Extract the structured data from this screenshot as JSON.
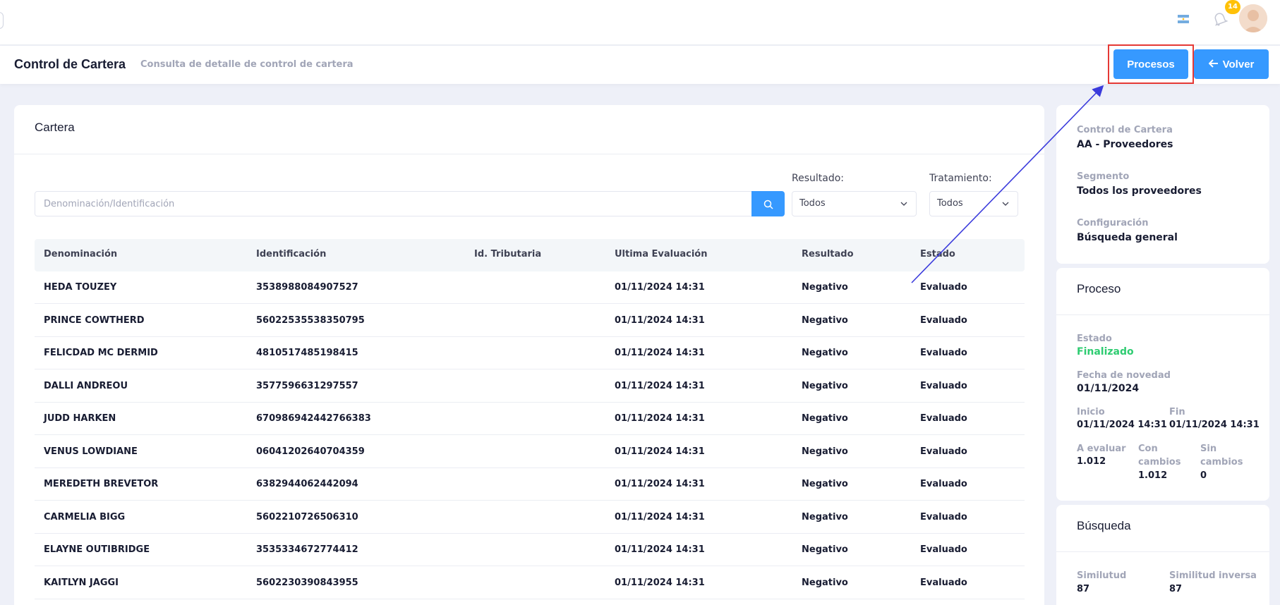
{
  "topbar": {
    "notification_count": "14",
    "flag_icon": "argentina-flag-icon",
    "bell_icon": "bell-icon"
  },
  "header": {
    "title": "Control de Cartera",
    "subtitle": "Consulta de detalle de control de cartera",
    "procesos_label": "Procesos",
    "volver_label": "Volver"
  },
  "cartera": {
    "title": "Cartera",
    "search_placeholder": "Denominación/Identificación",
    "resultado_label": "Resultado:",
    "resultado_value": "Todos",
    "tratamiento_label": "Tratamiento:",
    "tratamiento_value": "Todos",
    "columns": [
      "Denominación",
      "Identificación",
      "Id. Tributaria",
      "Ultima Evaluación",
      "Resultado",
      "Estado"
    ],
    "rows": [
      [
        "HEDA TOUZEY",
        "3538988084907527",
        "",
        "01/11/2024 14:31",
        "Negativo",
        "Evaluado"
      ],
      [
        "PRINCE COWTHERD",
        "56022535538350795",
        "",
        "01/11/2024 14:31",
        "Negativo",
        "Evaluado"
      ],
      [
        "FELICDAD MC DERMID",
        "4810517485198415",
        "",
        "01/11/2024 14:31",
        "Negativo",
        "Evaluado"
      ],
      [
        "DALLI ANDREOU",
        "3577596631297557",
        "",
        "01/11/2024 14:31",
        "Negativo",
        "Evaluado"
      ],
      [
        "JUDD HARKEN",
        "670986942442766383",
        "",
        "01/11/2024 14:31",
        "Negativo",
        "Evaluado"
      ],
      [
        "VENUS LOWDIANE",
        "06041202640704359",
        "",
        "01/11/2024 14:31",
        "Negativo",
        "Evaluado"
      ],
      [
        "MEREDETH BREVETOR",
        "6382944062442094",
        "",
        "01/11/2024 14:31",
        "Negativo",
        "Evaluado"
      ],
      [
        "CARMELIA BIGG",
        "5602210726506310",
        "",
        "01/11/2024 14:31",
        "Negativo",
        "Evaluado"
      ],
      [
        "ELAYNE OUTIBRIDGE",
        "3535334672774412",
        "",
        "01/11/2024 14:31",
        "Negativo",
        "Evaluado"
      ],
      [
        "KAITLYN JAGGI",
        "5602230390843955",
        "",
        "01/11/2024 14:31",
        "Negativo",
        "Evaluado"
      ]
    ]
  },
  "summary": {
    "control_label": "Control de Cartera",
    "control_value": "AA - Proveedores",
    "segmento_label": "Segmento",
    "segmento_value": "Todos los proveedores",
    "config_label": "Configuración",
    "config_value": "Búsqueda general"
  },
  "proceso": {
    "title": "Proceso",
    "estado_label": "Estado",
    "estado_value": "Finalizado",
    "fecha_label": "Fecha de novedad",
    "fecha_value": "01/11/2024",
    "inicio_label": "Inicio",
    "inicio_value": "01/11/2024 14:31",
    "fin_label": "Fin",
    "fin_value": "01/11/2024 14:31",
    "a_evaluar_label": "A evaluar",
    "a_evaluar_value": "1.012",
    "con_cambios_label_1": "Con",
    "con_cambios_label_2": "cambios",
    "con_cambios_value": "1.012",
    "sin_cambios_label_1": "Sin",
    "sin_cambios_label_2": "cambios",
    "sin_cambios_value": "0"
  },
  "busqueda": {
    "title": "Búsqueda",
    "similitud_label": "Similutud",
    "similitud_value": "87",
    "inversa_label": "Similitud inversa",
    "inversa_value": "87"
  },
  "colors": {
    "primary": "#3699ff",
    "success": "#2ecc71",
    "badge": "#ffc107",
    "annotation": "#3b3bdc",
    "highlight": "#e53935"
  }
}
